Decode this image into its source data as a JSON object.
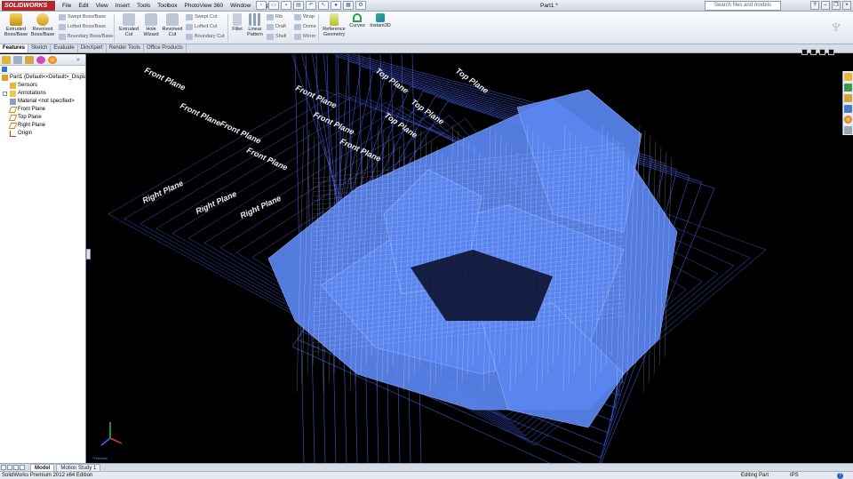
{
  "app": {
    "logo_text": "SOLIDWORKS",
    "document_title": "Part1 *",
    "search_placeholder": "Search files and models"
  },
  "menu": [
    "File",
    "Edit",
    "View",
    "Insert",
    "Tools",
    "Toolbox",
    "PhotoView 360",
    "Window",
    "Help"
  ],
  "ribbon": {
    "extruded_boss": "Extruded Boss/Base",
    "revolved_boss": "Revolved Boss/Base",
    "swept_boss": "Swept Boss/Base",
    "lofted_boss": "Lofted Boss/Base",
    "boundary_boss": "Boundary Boss/Base",
    "extruded_cut": "Extruded Cut",
    "hole_wizard": "Hole Wizard",
    "revolved_cut": "Revolved Cut",
    "swept_cut": "Swept Cut",
    "lofted_cut": "Lofted Cut",
    "boundary_cut": "Boundary Cut",
    "fillet": "Fillet",
    "linear_pattern": "Linear Pattern",
    "rib": "Rib",
    "draft": "Draft",
    "shell": "Shell",
    "wrap": "Wrap",
    "dome": "Dome",
    "mirror": "Mirror",
    "reference_geometry": "Reference Geometry",
    "curves": "Curves",
    "instant3d": "Instant3D"
  },
  "tabs": [
    "Features",
    "Sketch",
    "Evaluate",
    "DimXpert",
    "Render Tools",
    "Office Products"
  ],
  "feature_tree": {
    "root": "Part1  (Default<<Default>_Displa",
    "items": [
      "Sensors",
      "Annotations",
      "Material <not specified>",
      "Front Plane",
      "Top Plane",
      "Right Plane",
      "Origin"
    ]
  },
  "plane_labels": {
    "front": "Front Plane",
    "top": "Top Plane",
    "right": "Right Plane"
  },
  "triad_label": "*Trimetric",
  "bottom_tabs": [
    "Model",
    "Motion Study 1"
  ],
  "status": {
    "edition": "SolidWorks Premium 2012 x64 Edition",
    "mode": "Editing Part",
    "units": "IPS",
    "help": "?"
  },
  "colors": {
    "model_fill": "#5b86f0",
    "plane_lines": "#3e59d8",
    "viewport_bg": "#000000",
    "logo_red": "#b3262c"
  }
}
